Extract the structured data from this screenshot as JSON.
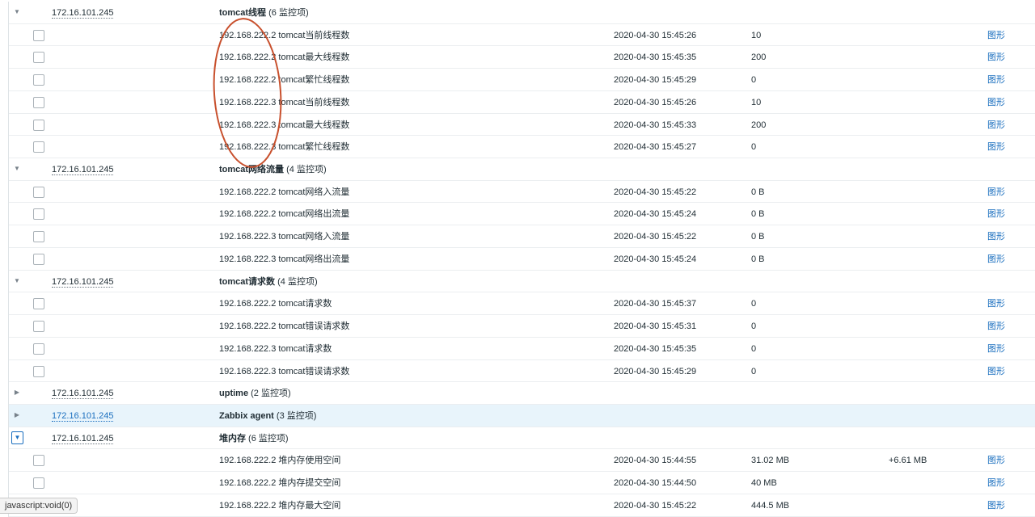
{
  "groups": [
    {
      "host": "172.16.101.245",
      "app_name": "tomcat线程",
      "app_count": " (6 监控项)",
      "expanded": true,
      "items": [
        {
          "name": "192.168.222.2 tomcat当前线程数",
          "lastcheck": "2020-04-30 15:45:26",
          "value": "10",
          "change": "",
          "graph": "图形"
        },
        {
          "name": "192.168.222.2 tomcat最大线程数",
          "lastcheck": "2020-04-30 15:45:35",
          "value": "200",
          "change": "",
          "graph": "图形"
        },
        {
          "name": "192.168.222.2 tomcat繁忙线程数",
          "lastcheck": "2020-04-30 15:45:29",
          "value": "0",
          "change": "",
          "graph": "图形"
        },
        {
          "name": "192.168.222.3 tomcat当前线程数",
          "lastcheck": "2020-04-30 15:45:26",
          "value": "10",
          "change": "",
          "graph": "图形"
        },
        {
          "name": "192.168.222.3 tomcat最大线程数",
          "lastcheck": "2020-04-30 15:45:33",
          "value": "200",
          "change": "",
          "graph": "图形"
        },
        {
          "name": "192.168.222.3 tomcat繁忙线程数",
          "lastcheck": "2020-04-30 15:45:27",
          "value": "0",
          "change": "",
          "graph": "图形"
        }
      ]
    },
    {
      "host": "172.16.101.245",
      "app_name": "tomcat网络流量",
      "app_count": " (4 监控项)",
      "expanded": true,
      "items": [
        {
          "name": "192.168.222.2 tomcat网络入流量",
          "lastcheck": "2020-04-30 15:45:22",
          "value": "0 B",
          "change": "",
          "graph": "图形"
        },
        {
          "name": "192.168.222.2 tomcat网络出流量",
          "lastcheck": "2020-04-30 15:45:24",
          "value": "0 B",
          "change": "",
          "graph": "图形"
        },
        {
          "name": "192.168.222.3 tomcat网络入流量",
          "lastcheck": "2020-04-30 15:45:22",
          "value": "0 B",
          "change": "",
          "graph": "图形"
        },
        {
          "name": "192.168.222.3 tomcat网络出流量",
          "lastcheck": "2020-04-30 15:45:24",
          "value": "0 B",
          "change": "",
          "graph": "图形"
        }
      ]
    },
    {
      "host": "172.16.101.245",
      "app_name": "tomcat请求数",
      "app_count": " (4 监控项)",
      "expanded": true,
      "items": [
        {
          "name": "192.168.222.2 tomcat请求数",
          "lastcheck": "2020-04-30 15:45:37",
          "value": "0",
          "change": "",
          "graph": "图形"
        },
        {
          "name": "192.168.222.2 tomcat错误请求数",
          "lastcheck": "2020-04-30 15:45:31",
          "value": "0",
          "change": "",
          "graph": "图形"
        },
        {
          "name": "192.168.222.3 tomcat请求数",
          "lastcheck": "2020-04-30 15:45:35",
          "value": "0",
          "change": "",
          "graph": "图形"
        },
        {
          "name": "192.168.222.3 tomcat错误请求数",
          "lastcheck": "2020-04-30 15:45:29",
          "value": "0",
          "change": "",
          "graph": "图形"
        }
      ]
    },
    {
      "host": "172.16.101.245",
      "app_name": "uptime",
      "app_count": " (2 监控项)",
      "expanded": false,
      "items": []
    },
    {
      "host": "172.16.101.245",
      "app_name": "Zabbix agent",
      "app_count": " (3 监控项)",
      "expanded": false,
      "hover": true,
      "items": []
    },
    {
      "host": "172.16.101.245",
      "app_name": "堆内存",
      "app_count": " (6 监控项)",
      "expanded": true,
      "focused": true,
      "items": [
        {
          "name": "192.168.222.2 堆内存使用空间",
          "lastcheck": "2020-04-30 15:44:55",
          "value": "31.02 MB",
          "change": "+6.61 MB",
          "graph": "图形"
        },
        {
          "name": "192.168.222.2 堆内存提交空间",
          "lastcheck": "2020-04-30 15:44:50",
          "value": "40 MB",
          "change": "",
          "graph": "图形"
        },
        {
          "name": "192.168.222.2 堆内存最大空间",
          "lastcheck": "2020-04-30 15:45:22",
          "value": "444.5 MB",
          "change": "",
          "graph": "图形"
        }
      ]
    }
  ],
  "icons": {
    "expanded": "triangle-down-icon",
    "collapsed": "triangle-right-icon"
  },
  "colors": {
    "link": "#1b6fbf",
    "row_hover": "#e8f4fb",
    "annotation": "#c8502d",
    "border": "#ebeef0"
  },
  "status_bar": {
    "text": "javascript:void(0)"
  }
}
